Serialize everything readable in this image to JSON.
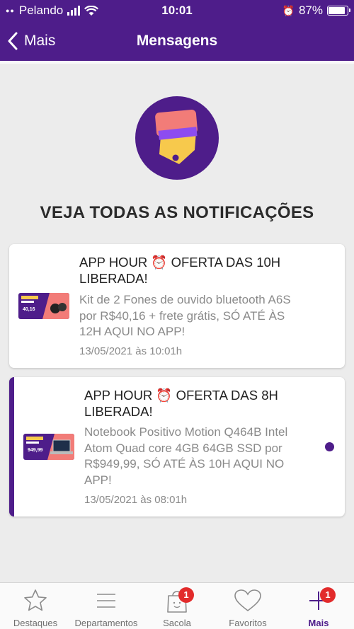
{
  "status_bar": {
    "carrier": "Pelando",
    "time": "10:01",
    "battery": "87%",
    "battery_level": 0.87
  },
  "nav": {
    "back_label": "Mais",
    "title": "Mensagens"
  },
  "section_title": "VEJA TODAS AS NOTIFICAÇÕES",
  "notifications": [
    {
      "title_line1": "APP HOUR ⏰ OFERTA DAS 10H",
      "title_line2": "LIBERADA!",
      "body_lines": [
        "Kit de 2 Fones de ouvido bluetooth A6S",
        "por R$40,16 + frete grátis, SÓ ATÉ ÀS",
        "12H AQUI NO APP!"
      ],
      "date": "13/05/2021 às 10:01h",
      "thumb_price": "40,16",
      "unread": false
    },
    {
      "title_line1": "APP HOUR ⏰ OFERTA DAS 8H",
      "title_line2": "LIBERADA!",
      "body_lines": [
        "Notebook Positivo Motion Q464B Intel",
        "Atom Quad core 4GB 64GB SSD por",
        "R$949,99, SÓ ATÉ ÀS 10H AQUI NO",
        "APP!"
      ],
      "date": "13/05/2021 às 08:01h",
      "thumb_price": "949,99",
      "unread": true
    }
  ],
  "tabs": [
    {
      "label": "Destaques",
      "icon": "star-icon"
    },
    {
      "label": "Departamentos",
      "icon": "menu-icon"
    },
    {
      "label": "Sacola",
      "icon": "bag-icon",
      "badge": "1"
    },
    {
      "label": "Favoritos",
      "icon": "heart-icon"
    },
    {
      "label": "Mais",
      "icon": "plus-icon",
      "badge": "1",
      "active": true
    }
  ],
  "colors": {
    "brand": "#4e1d8a",
    "badge": "#e22b2b",
    "background": "#ececec"
  }
}
